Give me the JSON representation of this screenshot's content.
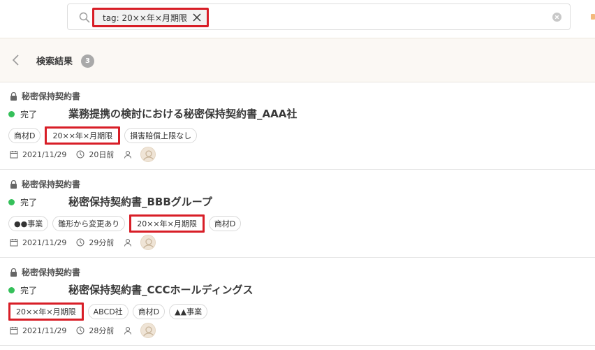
{
  "search": {
    "chip_label": "tag: 20××年×月期限",
    "chip_close_icon": "close-icon",
    "search_icon": "search-icon",
    "clear_icon": "clear-circle-icon"
  },
  "results_header": {
    "back_icon": "chevron-left-icon",
    "title": "検索結果",
    "count": "3"
  },
  "results": [
    {
      "doc_type": "秘密保持契約書",
      "status": "完了",
      "title": "業務提携の検討における秘密保持契約書_AAA社",
      "tags": [
        {
          "label": "商材D",
          "highlight": false
        },
        {
          "label": "20××年×月期限",
          "highlight": true
        },
        {
          "label": "損害賠償上限なし",
          "highlight": false
        }
      ],
      "date": "2021/11/29",
      "time_ago": "20日前"
    },
    {
      "doc_type": "秘密保持契約書",
      "status": "完了",
      "title": "秘密保持契約書_BBBグループ",
      "tags": [
        {
          "label": "●●事業",
          "highlight": false
        },
        {
          "label": "雛形から変更あり",
          "highlight": false
        },
        {
          "label": "20××年×月期限",
          "highlight": true
        },
        {
          "label": "商材D",
          "highlight": false
        }
      ],
      "date": "2021/11/29",
      "time_ago": "29分前"
    },
    {
      "doc_type": "秘密保持契約書",
      "status": "完了",
      "title": "秘密保持契約書_CCCホールディングス",
      "tags": [
        {
          "label": "20××年×月期限",
          "highlight": true
        },
        {
          "label": "ABCD社",
          "highlight": false
        },
        {
          "label": "商材D",
          "highlight": false
        },
        {
          "label": "▲▲事業",
          "highlight": false
        }
      ],
      "date": "2021/11/29",
      "time_ago": "28分前"
    }
  ],
  "colors": {
    "status_done": "#35c05a",
    "highlight_border": "#d81e27",
    "header_bg": "#fbf8f4",
    "count_badge": "#a9a9a9"
  }
}
